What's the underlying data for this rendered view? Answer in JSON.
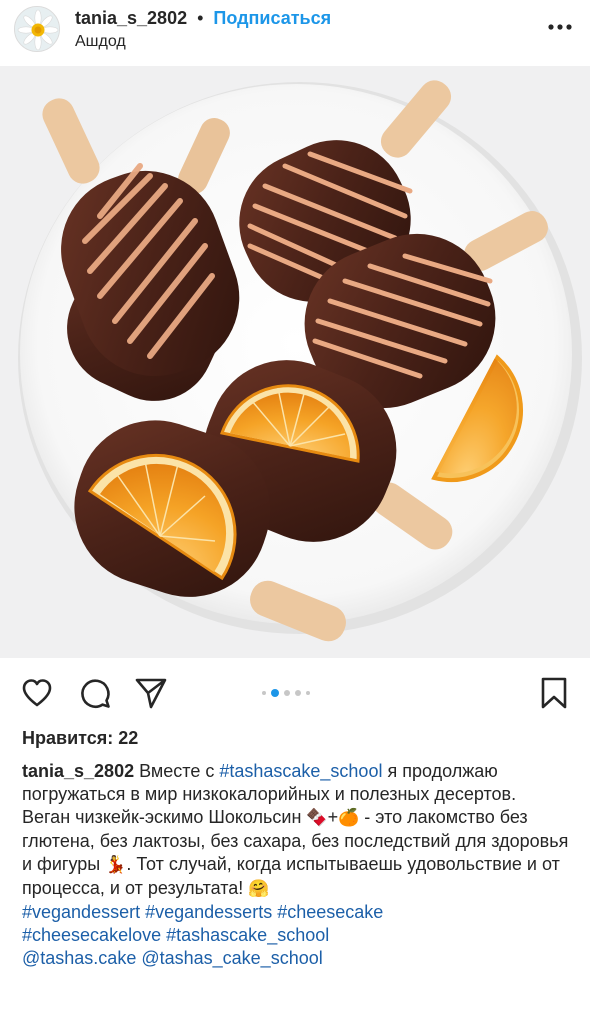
{
  "post": {
    "username": "tania_s_2802",
    "separator": "•",
    "follow_label": "Подписаться",
    "location": "Ашдод",
    "more_icon": "ellipsis-icon"
  },
  "photo": {
    "subject": "chocolate-eskimo-popsicles-with-dried-orange"
  },
  "actions": {
    "like_icon": "heart-icon",
    "comment_icon": "comment-icon",
    "share_icon": "send-icon",
    "save_icon": "bookmark-icon",
    "carousel_total": 5,
    "carousel_active_index": 1
  },
  "likes": {
    "text": "Нравится: 22"
  },
  "caption": {
    "username": "tania_s_2802",
    "line1_before": " Вместе с ",
    "mention_school": "#tashascake_school",
    "line1_after": " я продолжаю погружаться в мир низкокалорийных и полезных десертов.",
    "para2_a": "Веган чизкейк-эскимо Шокольсин ",
    "para2_emoji1": "🍫",
    "para2_plus": "+",
    "para2_emoji2": "🍊",
    "para2_b": " - это лакомство без глютена, без лактозы, без сахара, без последствий для здоровья и фигуры ",
    "para2_emoji3": "💃",
    "para2_c": ". Тот случай, когда испытываешь удовольствие и от процесса, и от результата! ",
    "para2_emoji4": "🤗",
    "hashtags_line1": [
      "#vegandessert",
      "#vegandesserts",
      "#cheesecake"
    ],
    "hashtags_line2": [
      "#cheesecakelove",
      "#tashascake_school"
    ],
    "mentions_line3": [
      "@tashas.cake",
      "@tashas_cake_school"
    ]
  },
  "colors": {
    "link_blue": "#1c96e8",
    "hashtag_blue": "#1c5fa8",
    "text": "#262626",
    "chocolate": "#4a2218",
    "drizzle": "#e5a27c",
    "orange": "#f0961e",
    "stick": "#e9c39a"
  }
}
